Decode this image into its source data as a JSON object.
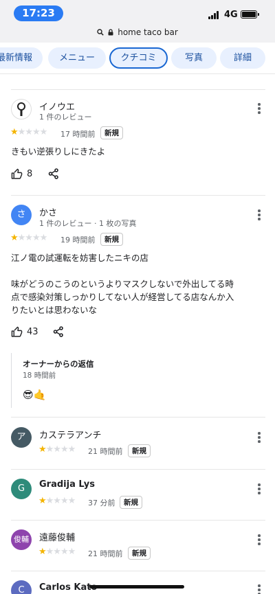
{
  "status_bar": {
    "time": "17:23",
    "network": "4G"
  },
  "browser": {
    "url": "home taco bar"
  },
  "tabs": [
    {
      "label": "最新情報"
    },
    {
      "label": "メニュー"
    },
    {
      "label": "クチコミ",
      "active": true
    },
    {
      "label": "写真"
    },
    {
      "label": "詳細"
    }
  ],
  "reviews": [
    {
      "avatar_text": "",
      "avatar_color": "#ffffff",
      "name": "イノウエ",
      "meta": "1 件のレビュー",
      "stars": 1,
      "time_ago": "17 時間前",
      "badge": "新規",
      "text": "きもい逆張りしにきたよ",
      "likes": "8"
    },
    {
      "avatar_text": "さ",
      "avatar_color": "#4285f4",
      "name": "かさ",
      "meta": "1 件のレビュー · 1 枚の写真",
      "stars": 1,
      "time_ago": "19 時間前",
      "badge": "新規",
      "text_lines": [
        "江ノ電の試運転を妨害したニキの店",
        "",
        "味がどうのこうのというよりマスクしないで外出してる時",
        "点で感染対策しっかりしてない人が経営してる店なんか入",
        "りたいとは思わないな"
      ],
      "likes": "43",
      "owner_reply": {
        "title": "オーナーからの返信",
        "time": "18 時間前",
        "content": "😎🤙"
      }
    },
    {
      "avatar_text": "ア",
      "avatar_color": "#455a64",
      "name": "カステラアンチ",
      "stars": 1,
      "time_ago": "21 時間前",
      "badge": "新規"
    },
    {
      "avatar_text": "G",
      "avatar_color": "#2e8b7a",
      "name": "Gradija Lys",
      "stars": 1,
      "time_ago": "37 分前",
      "badge": "新規"
    },
    {
      "avatar_text": "俊輔",
      "avatar_color": "#8e44ad",
      "name": "遠藤俊輔",
      "stars": 1,
      "time_ago": "21 時間前",
      "badge": "新規"
    },
    {
      "avatar_text": "C",
      "avatar_color": "#5c6bc0",
      "name": "Carlos Kato"
    }
  ],
  "icons": {
    "search": "search-icon",
    "lock": "lock-icon",
    "like": "thumbs-up-icon",
    "share": "share-icon",
    "more": "more-vert-icon"
  },
  "colors": {
    "star_on": "#f4b400",
    "star_off": "#dadce0",
    "tab_bg": "#e8f0fe",
    "tab_active_border": "#1967d2"
  }
}
